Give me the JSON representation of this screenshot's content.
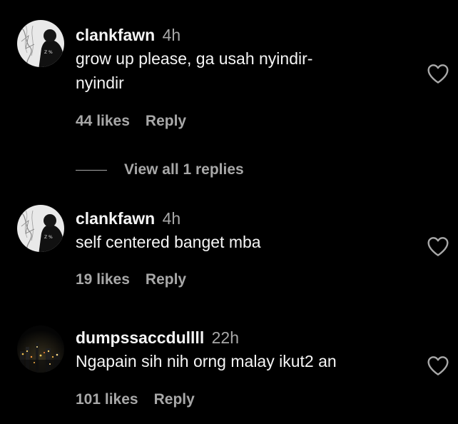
{
  "comments": [
    {
      "username": "clankfawn",
      "time": "4h",
      "text_lines": [
        "grow up please, ga usah nyindir-",
        "nyindir"
      ],
      "likes": "44 likes",
      "reply": "Reply",
      "avatar": "avatar-sketch-figure"
    },
    {
      "username": "clankfawn",
      "time": "4h",
      "text_lines": [
        "self centered banget mba"
      ],
      "likes": "19 likes",
      "reply": "Reply",
      "avatar": "avatar-sketch-figure"
    },
    {
      "username": "dumpssaccdullll",
      "time": "22h",
      "text_lines": [
        "Ngapain sih nih orng malay ikut2 an"
      ],
      "likes": "101 likes",
      "reply": "Reply",
      "avatar": "avatar-night-city"
    }
  ],
  "view_replies": "View all 1 replies",
  "icons": {
    "like": "heart-outline-icon"
  },
  "colors": {
    "background": "#000000",
    "primary_text": "#f5f5f5",
    "secondary_text": "#a8a8a8"
  }
}
